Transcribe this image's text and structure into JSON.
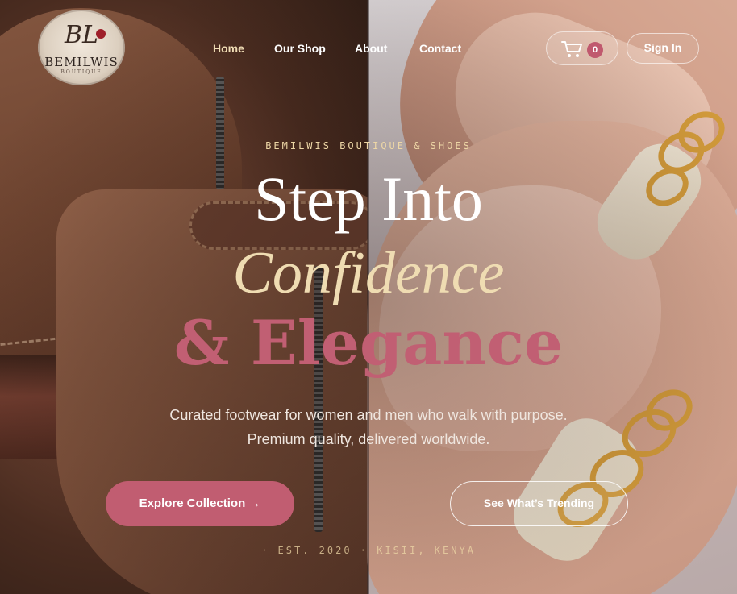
{
  "brand": {
    "monogram": "BL",
    "name": "BEMILWIS",
    "tagline": "BOUTIQUE"
  },
  "nav": {
    "items": [
      {
        "label": "Home",
        "active": true
      },
      {
        "label": "Our Shop",
        "active": false
      },
      {
        "label": "About",
        "active": false
      },
      {
        "label": "Contact",
        "active": false
      }
    ],
    "cart_count": "0",
    "sign_in_label": "Sign In"
  },
  "hero": {
    "eyebrow": "BEMILWIS BOUTIQUE & SHOES",
    "headline_line1": "Step Into",
    "headline_line2": "Confidence",
    "headline_line3": "& Elegance",
    "subtitle": "Curated footwear for women and men who walk with purpose. Premium quality, delivered worldwide.",
    "primary_cta": "Explore Collection →",
    "secondary_cta": "See What’s Trending",
    "footnote": "· EST. 2020 · KISII, KENYA"
  },
  "icons": {
    "cart": "cart-icon",
    "logo": "logo-emblem"
  },
  "colors": {
    "accent": "#c15d71",
    "gold_text": "#efdcb2",
    "nav_active": "#f1deb6"
  }
}
